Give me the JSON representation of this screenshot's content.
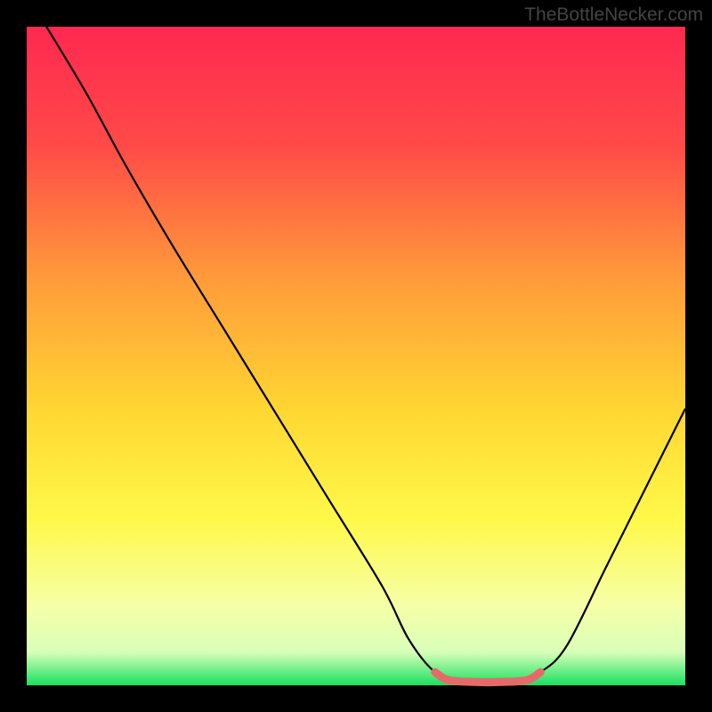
{
  "watermark": "TheBottleNecker.com",
  "chart_data": {
    "type": "line",
    "title": "",
    "xlabel": "",
    "ylabel": "",
    "xlim": [
      0,
      100
    ],
    "ylim": [
      0,
      100
    ],
    "background_gradient": {
      "top": "#ff2850",
      "mid_upper": "#ff7a3c",
      "mid": "#ffdc32",
      "mid_lower": "#faff60",
      "lower": "#f5ffb4",
      "bottom": "#18e060"
    },
    "series": [
      {
        "name": "main-curve",
        "color": "#000000",
        "points": [
          {
            "x": 3,
            "y": 100
          },
          {
            "x": 9,
            "y": 90
          },
          {
            "x": 15,
            "y": 79
          },
          {
            "x": 22,
            "y": 67
          },
          {
            "x": 30,
            "y": 54
          },
          {
            "x": 38,
            "y": 41
          },
          {
            "x": 46,
            "y": 28
          },
          {
            "x": 54,
            "y": 15
          },
          {
            "x": 58,
            "y": 7
          },
          {
            "x": 62,
            "y": 2
          },
          {
            "x": 66,
            "y": 0.5
          },
          {
            "x": 74,
            "y": 0.5
          },
          {
            "x": 78,
            "y": 2
          },
          {
            "x": 82,
            "y": 6
          },
          {
            "x": 88,
            "y": 18
          },
          {
            "x": 94,
            "y": 30
          },
          {
            "x": 100,
            "y": 42
          }
        ]
      },
      {
        "name": "highlight-segment",
        "color": "#e66a6a",
        "stroke_width": 6,
        "points": [
          {
            "x": 62,
            "y": 2
          },
          {
            "x": 64,
            "y": 0.8
          },
          {
            "x": 68,
            "y": 0.5
          },
          {
            "x": 72,
            "y": 0.5
          },
          {
            "x": 76,
            "y": 0.8
          },
          {
            "x": 78,
            "y": 2
          }
        ]
      }
    ]
  }
}
